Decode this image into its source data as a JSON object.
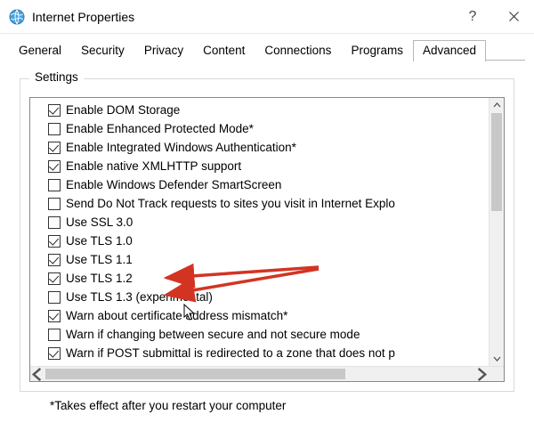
{
  "window": {
    "title": "Internet Properties",
    "help_label": "?",
    "close_label": "Close"
  },
  "tabs": [
    {
      "label": "General",
      "active": false
    },
    {
      "label": "Security",
      "active": false
    },
    {
      "label": "Privacy",
      "active": false
    },
    {
      "label": "Content",
      "active": false
    },
    {
      "label": "Connections",
      "active": false
    },
    {
      "label": "Programs",
      "active": false
    },
    {
      "label": "Advanced",
      "active": true
    }
  ],
  "group": {
    "label": "Settings",
    "footnote": "*Takes effect after you restart your computer"
  },
  "settings_list": [
    {
      "label": "Enable DOM Storage",
      "checked": true
    },
    {
      "label": "Enable Enhanced Protected Mode*",
      "checked": false
    },
    {
      "label": "Enable Integrated Windows Authentication*",
      "checked": true
    },
    {
      "label": "Enable native XMLHTTP support",
      "checked": true
    },
    {
      "label": "Enable Windows Defender SmartScreen",
      "checked": false
    },
    {
      "label": "Send Do Not Track requests to sites you visit in Internet Explo",
      "checked": false
    },
    {
      "label": "Use SSL 3.0",
      "checked": false
    },
    {
      "label": "Use TLS 1.0",
      "checked": true
    },
    {
      "label": "Use TLS 1.1",
      "checked": true
    },
    {
      "label": "Use TLS 1.2",
      "checked": true
    },
    {
      "label": "Use TLS 1.3 (experimental)",
      "checked": false
    },
    {
      "label": "Warn about certificate address mismatch*",
      "checked": true
    },
    {
      "label": "Warn if changing between secure and not secure mode",
      "checked": false
    },
    {
      "label": "Warn if POST submittal is redirected to a zone that does not p",
      "checked": true
    }
  ],
  "annotations": {
    "arrows_target": [
      "Use TLS 1.1",
      "Use TLS 1.2"
    ],
    "arrow_color": "#d33422"
  }
}
